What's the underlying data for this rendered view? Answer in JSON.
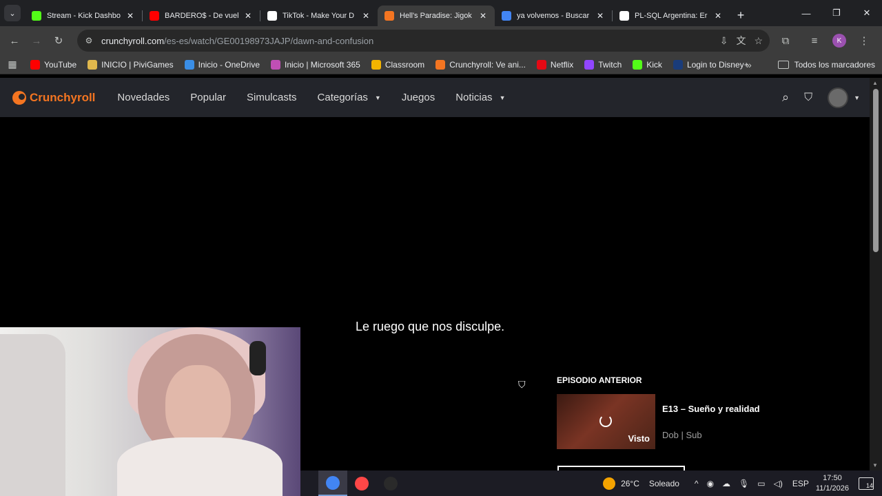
{
  "browser": {
    "tabs": [
      {
        "title": "Stream - Kick Dashbo",
        "icon": "kick-icon",
        "color": "#53fc18",
        "active": false
      },
      {
        "title": "BARDERO$ - De vuel",
        "icon": "youtube-icon",
        "color": "#ff0000",
        "active": false
      },
      {
        "title": "TikTok - Make Your D",
        "icon": "tiktok-icon",
        "color": "#ffffff",
        "active": false
      },
      {
        "title": "Hell's Paradise: Jigok",
        "icon": "crunchyroll-icon",
        "color": "#f47521",
        "active": true
      },
      {
        "title": "ya volvemos - Buscar",
        "icon": "google-icon",
        "color": "#4285f4",
        "active": false
      },
      {
        "title": "PL-SQL Argentina: Er",
        "icon": "pl-sql-icon",
        "color": "#ffffff",
        "active": false
      }
    ],
    "url_domain": "crunchyroll.com",
    "url_path": "/es-es/watch/GE00198973JAJP/dawn-and-confusion",
    "profile_initial": "K",
    "bookmarks": [
      {
        "label": "YouTube",
        "icon": "youtube-icon",
        "color": "#ff0000"
      },
      {
        "label": "INICIO | PiviGames",
        "icon": "pivigames-icon",
        "color": "#e0b84d"
      },
      {
        "label": "Inicio - OneDrive",
        "icon": "onedrive-icon",
        "color": "#3a8ee6"
      },
      {
        "label": "Inicio | Microsoft 365",
        "icon": "microsoft-365-icon",
        "color": "#c04fb5"
      },
      {
        "label": "Classroom",
        "icon": "classroom-icon",
        "color": "#f4b400"
      },
      {
        "label": "Crunchyroll: Ve ani...",
        "icon": "crunchyroll-icon",
        "color": "#f47521"
      },
      {
        "label": "Netflix",
        "icon": "netflix-icon",
        "color": "#e50914"
      },
      {
        "label": "Twitch",
        "icon": "twitch-icon",
        "color": "#9146ff"
      },
      {
        "label": "Kick",
        "icon": "kick-icon",
        "color": "#53fc18"
      },
      {
        "label": "Login to Disney+",
        "icon": "disney-plus-icon",
        "color": "#1a3c7a"
      }
    ],
    "all_bookmarks_label": "Todos los marcadores"
  },
  "site": {
    "logo_text": "Crunchyroll",
    "brand_color": "#f47521",
    "nav": [
      {
        "label": "Novedades",
        "has_caret": false
      },
      {
        "label": "Popular",
        "has_caret": false
      },
      {
        "label": "Simulcasts",
        "has_caret": false
      },
      {
        "label": "Categorías",
        "has_caret": true
      },
      {
        "label": "Juegos",
        "has_caret": false
      },
      {
        "label": "Noticias",
        "has_caret": true
      }
    ]
  },
  "player": {
    "error_message": "Le ruego que nos disculpe."
  },
  "previous_episode": {
    "heading": "EPISODIO ANTERIOR",
    "title": "E13 – Sueño y realidad",
    "meta": "Dob | Sub",
    "watched_label": "Visto"
  },
  "taskbar": {
    "apps": [
      {
        "icon": "chrome-icon",
        "color": "#4285f4",
        "active": true
      },
      {
        "icon": "ea-icon",
        "color": "#ff4747",
        "active": false
      },
      {
        "icon": "obs-icon",
        "color": "#2a2a2a",
        "active": false
      }
    ],
    "weather_temp": "26°C",
    "weather_desc": "Soleado",
    "language": "ESP",
    "time": "17:50",
    "date": "11/1/2026",
    "notification_count": "14"
  }
}
